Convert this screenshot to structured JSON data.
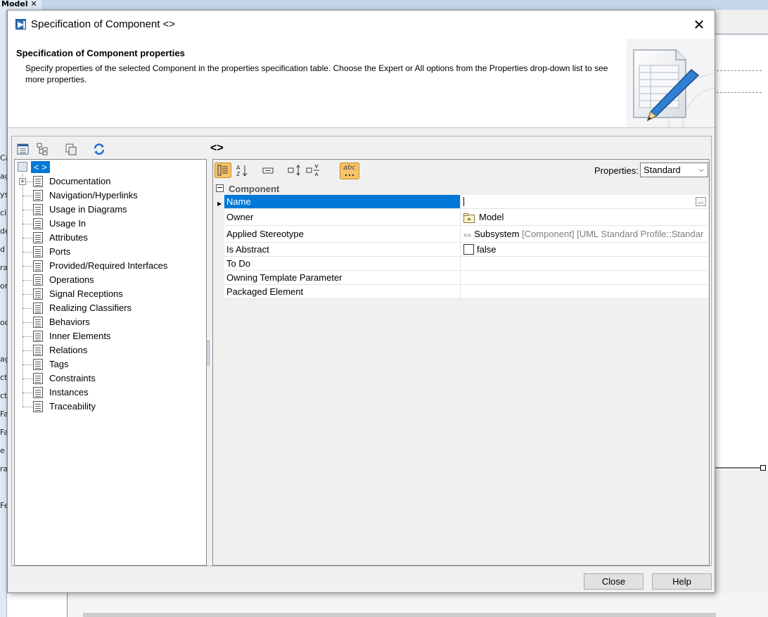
{
  "background": {
    "tab_label": "Model",
    "tab_close": "✕",
    "side_letters": [
      "Ca",
      "ag",
      "ys",
      "ci",
      "de",
      "d",
      "ra",
      "or",
      "oo",
      "ag",
      "ct",
      "ct",
      "Fa",
      "Fa",
      "e",
      "ra",
      "Fe"
    ]
  },
  "dialog": {
    "title": "Specification of Component <>",
    "close_glyph": "✕",
    "header": {
      "title": "Specification of Component properties",
      "description": "Specify properties of the selected Component in the properties specification table. Choose the Expert or All options from the Properties drop-down list to see more properties."
    },
    "element_title": "<>",
    "tree": {
      "root_label": "< >",
      "items": [
        {
          "label": "Documentation"
        },
        {
          "label": "Navigation/Hyperlinks"
        },
        {
          "label": "Usage in Diagrams"
        },
        {
          "label": "Usage In"
        },
        {
          "label": "Attributes"
        },
        {
          "label": "Ports"
        },
        {
          "label": "Provided/Required Interfaces"
        },
        {
          "label": "Operations"
        },
        {
          "label": "Signal Receptions"
        },
        {
          "label": "Realizing Classifiers"
        },
        {
          "label": "Behaviors"
        },
        {
          "label": "Inner Elements"
        },
        {
          "label": "Relations"
        },
        {
          "label": "Tags"
        },
        {
          "label": "Constraints"
        },
        {
          "label": "Instances"
        },
        {
          "label": "Traceability"
        }
      ]
    },
    "properties": {
      "label": "Properties:",
      "selected": "Standard",
      "abc_label": "abc",
      "category": "Component",
      "rows": [
        {
          "name": "Name",
          "value": ""
        },
        {
          "name": "Owner",
          "value": "Model"
        },
        {
          "name": "Applied Stereotype",
          "value": "Subsystem",
          "value_extra": "[Component] [UML Standard Profile::Standar"
        },
        {
          "name": "Is Abstract",
          "value": "false"
        },
        {
          "name": "To Do",
          "value": ""
        },
        {
          "name": "Owning Template Parameter",
          "value": ""
        },
        {
          "name": "Packaged Element",
          "value": ""
        }
      ]
    },
    "buttons": {
      "close": "Close",
      "help": "Help"
    },
    "colors": {
      "selection": "#0078d7",
      "dialog_bg": "#f0f0f0"
    }
  }
}
